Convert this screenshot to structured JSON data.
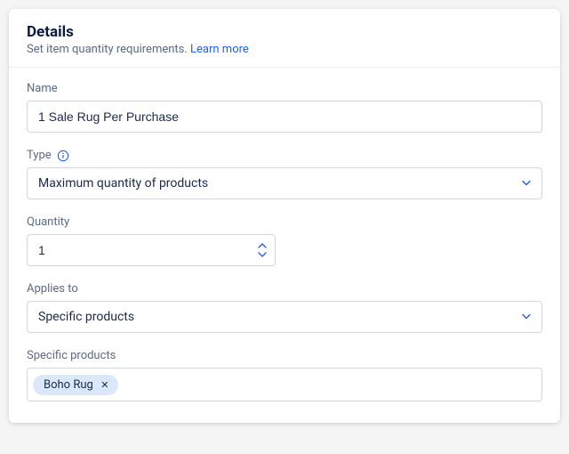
{
  "header": {
    "title": "Details",
    "subtitle": "Set item quantity requirements. ",
    "learn_more": "Learn more"
  },
  "fields": {
    "name": {
      "label": "Name",
      "value": "1 Sale Rug Per Purchase"
    },
    "type": {
      "label": "Type",
      "value": "Maximum quantity of products"
    },
    "quantity": {
      "label": "Quantity",
      "value": "1"
    },
    "applies_to": {
      "label": "Applies to",
      "value": "Specific products"
    },
    "specific_products": {
      "label": "Specific products",
      "tags": [
        {
          "label": "Boho Rug"
        }
      ]
    }
  }
}
